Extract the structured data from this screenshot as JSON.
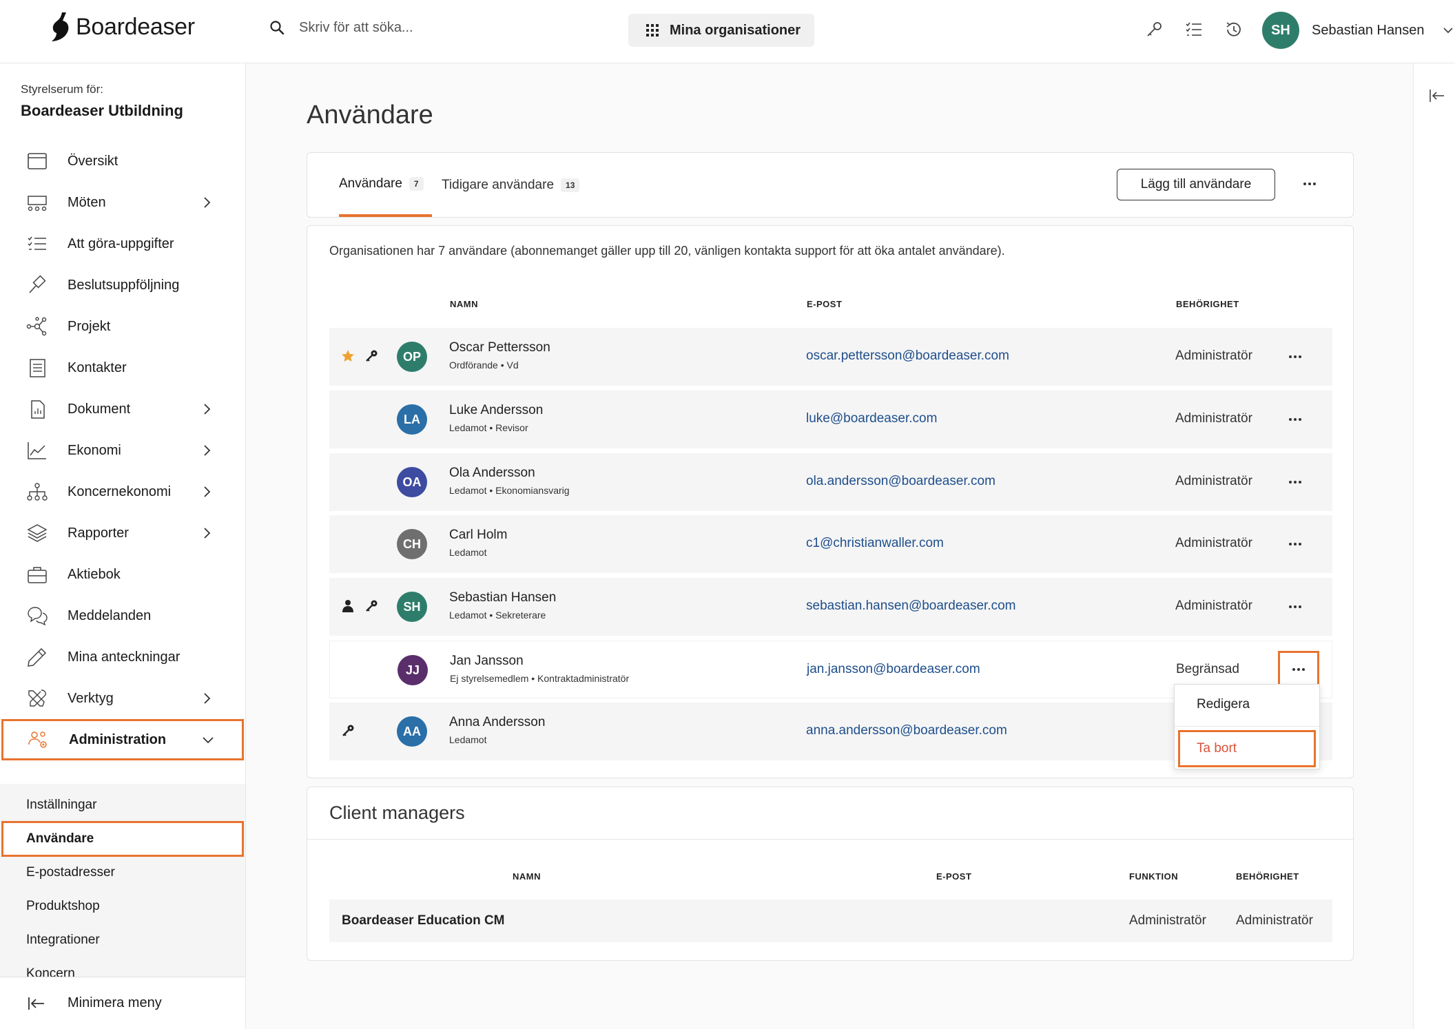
{
  "app": {
    "name": "Boardeaser"
  },
  "header": {
    "search_placeholder": "Skriv för att söka...",
    "org_button_label": "Mina organisationer",
    "icons": [
      "key-icon",
      "checklist-icon",
      "history-icon"
    ],
    "user": {
      "initials": "SH",
      "name": "Sebastian Hansen",
      "avatar_color": "#2e7d6b"
    }
  },
  "sidebar": {
    "caption": "Styrelserum för:",
    "org_name": "Boardeaser Utbildning",
    "items": [
      {
        "label": "Översikt",
        "icon": "calendar-icon",
        "has_children": false
      },
      {
        "label": "Möten",
        "icon": "meeting-icon",
        "has_children": true
      },
      {
        "label": "Att göra-uppgifter",
        "icon": "checklist-icon",
        "has_children": false
      },
      {
        "label": "Beslutsuppföljning",
        "icon": "gavel-icon",
        "has_children": false
      },
      {
        "label": "Projekt",
        "icon": "network-icon",
        "has_children": false
      },
      {
        "label": "Kontakter",
        "icon": "contacts-icon",
        "has_children": false
      },
      {
        "label": "Dokument",
        "icon": "document-icon",
        "has_children": true
      },
      {
        "label": "Ekonomi",
        "icon": "chart-icon",
        "has_children": true
      },
      {
        "label": "Koncernekonomi",
        "icon": "hierarchy-icon",
        "has_children": true
      },
      {
        "label": "Rapporter",
        "icon": "layers-icon",
        "has_children": true
      },
      {
        "label": "Aktiebok",
        "icon": "briefcase-icon",
        "has_children": false
      },
      {
        "label": "Meddelanden",
        "icon": "chat-icon",
        "has_children": false
      },
      {
        "label": "Mina anteckningar",
        "icon": "pencil-icon",
        "has_children": false
      },
      {
        "label": "Verktyg",
        "icon": "tools-icon",
        "has_children": true
      },
      {
        "label": "Administration",
        "icon": "admin-users-icon",
        "has_children": true,
        "expanded": true
      }
    ],
    "sub_items": [
      {
        "label": "Inställningar"
      },
      {
        "label": "Användare",
        "active": true
      },
      {
        "label": "E-postadresser"
      },
      {
        "label": "Produktshop"
      },
      {
        "label": "Integrationer"
      },
      {
        "label": "Koncern"
      }
    ],
    "footer_label": "Minimera meny"
  },
  "main": {
    "title": "Användare",
    "tabs": [
      {
        "label": "Användare",
        "count": "7",
        "active": true
      },
      {
        "label": "Tidigare användare",
        "count": "13",
        "active": false
      }
    ],
    "add_button_label": "Lägg till användare",
    "info_text": "Organisationen har 7 användare (abonnemanget gäller upp till 20, vänligen kontakta support för att öka antalet användare).",
    "columns": {
      "name": "NAMN",
      "email": "E-POST",
      "permission": "BEHÖRIGHET"
    },
    "users": [
      {
        "initials": "OP",
        "name": "Oscar Pettersson",
        "role": "Ordförande • Vd",
        "email": "oscar.pettersson@boardeaser.com",
        "permission": "Administratör",
        "color": "#2e7d6b",
        "marks": [
          "star-icon",
          "key-icon"
        ]
      },
      {
        "initials": "LA",
        "name": "Luke Andersson",
        "role": "Ledamot • Revisor",
        "email": "luke@boardeaser.com",
        "permission": "Administratör",
        "color": "#2a6fa8",
        "marks": []
      },
      {
        "initials": "OA",
        "name": "Ola Andersson",
        "role": "Ledamot • Ekonomiansvarig",
        "email": "ola.andersson@boardeaser.com",
        "permission": "Administratör",
        "color": "#3d4ba0",
        "marks": []
      },
      {
        "initials": "CH",
        "name": "Carl Holm",
        "role": "Ledamot",
        "email": "c1@christianwaller.com",
        "permission": "Administratör",
        "color": "#6f6f6f",
        "marks": []
      },
      {
        "initials": "SH",
        "name": "Sebastian Hansen",
        "role": "Ledamot • Sekreterare",
        "email": "sebastian.hansen@boardeaser.com",
        "permission": "Administratör",
        "color": "#2e7d6b",
        "marks": [
          "person-icon",
          "key-icon"
        ]
      },
      {
        "initials": "JJ",
        "name": "Jan Jansson",
        "role": "Ej styrelsemedlem • Kontraktadministratör",
        "email": "jan.jansson@boardeaser.com",
        "permission": "Begränsad",
        "color": "#5a2e6b",
        "marks": []
      },
      {
        "initials": "AA",
        "name": "Anna Andersson",
        "role": "Ledamot",
        "email": "anna.andersson@boardeaser.com",
        "permission": "",
        "color": "#2a6fa8",
        "marks": [
          "key-icon"
        ]
      }
    ],
    "row_menu": {
      "edit_label": "Redigera",
      "delete_label": "Ta bort"
    },
    "client_managers": {
      "title": "Client managers",
      "columns": {
        "name": "NAMN",
        "email": "E-POST",
        "function": "FUNKTION",
        "permission": "BEHÖRIGHET"
      },
      "rows": [
        {
          "name": "Boardeaser Education CM",
          "email": "",
          "function": "Administratör",
          "permission": "Administratör"
        }
      ]
    }
  },
  "colors": {
    "accent": "#e8732e",
    "link": "#1e4e8c",
    "delete": "#d9533a",
    "star": "#f0a030"
  }
}
